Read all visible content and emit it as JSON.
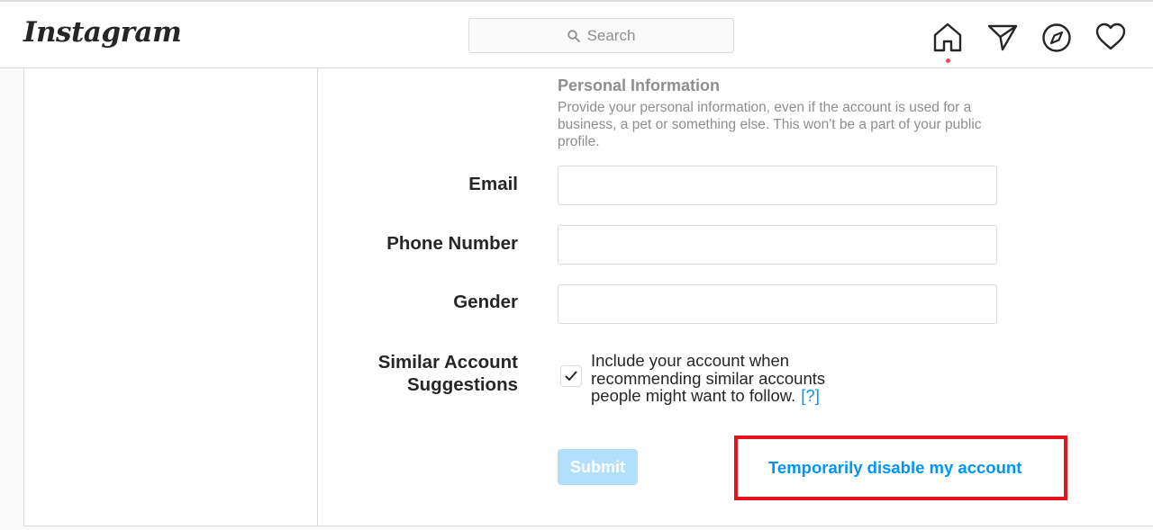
{
  "header": {
    "logo_text": "Instagram",
    "search_placeholder": "Search",
    "nav_icons": [
      "home-icon",
      "direct-message-icon",
      "explore-icon",
      "activity-heart-icon"
    ],
    "notification_dot_color": "#ed4956"
  },
  "form": {
    "section_title": "Personal Information",
    "section_description": "Provide your personal information, even if the account is used for a business, a pet or something else. This won't be a part of your public profile.",
    "fields": {
      "email": {
        "label": "Email",
        "value": ""
      },
      "phone": {
        "label": "Phone Number",
        "value": ""
      },
      "gender": {
        "label": "Gender",
        "value": ""
      }
    },
    "similar_accounts": {
      "label_line1": "Similar Account",
      "label_line2": "Suggestions",
      "checked": true,
      "text_line1": "Include your account when",
      "text_line2": "recommending similar accounts",
      "text_line3": "people might want to follow.",
      "help_text": "[?]"
    },
    "submit_label": "Submit",
    "disable_link_label": "Temporarily disable my account"
  },
  "colors": {
    "accent": "#0095f6",
    "submit_disabled_bg": "#b2dffc",
    "highlight": "#e3141e",
    "border": "#dbdbdb",
    "muted_text": "#8e8e8e"
  }
}
